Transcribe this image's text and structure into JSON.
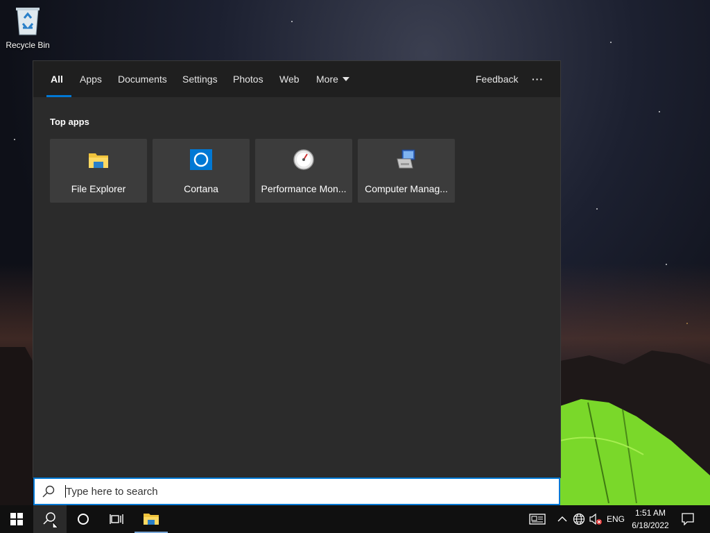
{
  "desktop": {
    "recycle_bin_label": "Recycle Bin"
  },
  "search_panel": {
    "tabs": [
      {
        "label": "All",
        "active": true
      },
      {
        "label": "Apps"
      },
      {
        "label": "Documents"
      },
      {
        "label": "Settings"
      },
      {
        "label": "Photos"
      },
      {
        "label": "Web"
      },
      {
        "label": "More"
      }
    ],
    "feedback_label": "Feedback",
    "more_options_label": "···",
    "top_apps_title": "Top apps",
    "top_apps": [
      {
        "label": "File Explorer",
        "icon": "file-explorer-icon"
      },
      {
        "label": "Cortana",
        "icon": "cortana-icon"
      },
      {
        "label": "Performance Mon...",
        "icon": "performance-monitor-icon"
      },
      {
        "label": "Computer Manag...",
        "icon": "computer-management-icon"
      }
    ]
  },
  "search_box": {
    "placeholder": "Type here to search"
  },
  "taskbar": {
    "language": "ENG",
    "time": "1:51 AM",
    "date": "6/18/2022"
  },
  "colors": {
    "accent": "#0078d4",
    "panel_bg": "#2b2b2b",
    "tabbar_bg": "#1f1f1f",
    "tile_bg": "#3c3c3c",
    "taskbar_bg": "#101010"
  }
}
